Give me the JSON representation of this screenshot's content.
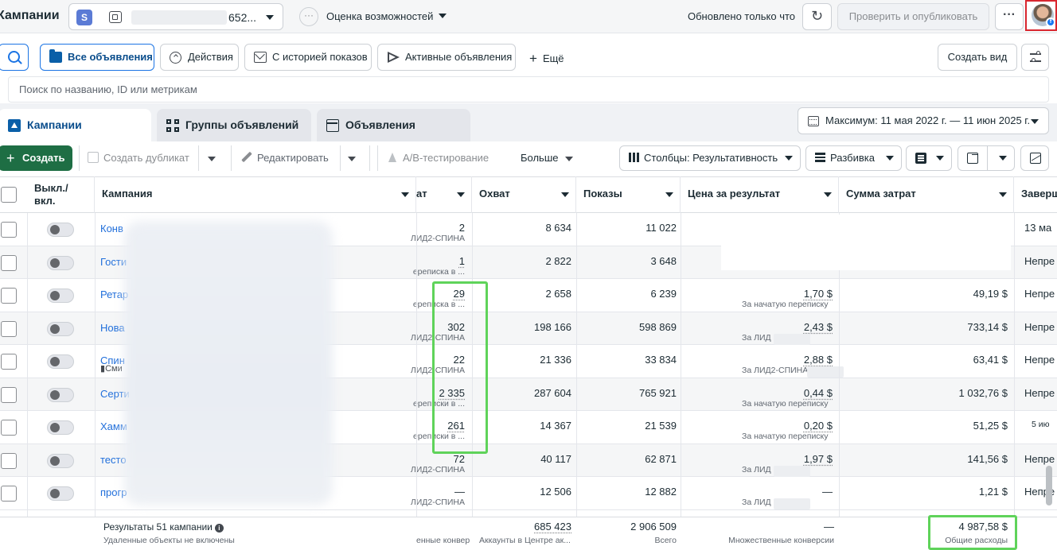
{
  "topbar": {
    "app_title": "Кампании",
    "account_badge": "S",
    "account_number": "652...",
    "opportunity_icon": "···",
    "opportunity_label": "Оценка возможностей",
    "updated_text": "Обновлено только что",
    "publish_label": "Проверить и опубликовать",
    "more_label": "···",
    "refresh_icon": "↻"
  },
  "filters": {
    "items": [
      {
        "label": "Все объявления",
        "icon": "folder-icon",
        "active": true
      },
      {
        "label": "Действия",
        "icon": "actions-icon",
        "active": false
      },
      {
        "label": "С историей показов",
        "icon": "envelope-icon",
        "active": false
      },
      {
        "label": "Активные объявления",
        "icon": "send-icon",
        "active": false
      }
    ],
    "more_label": "Ещё",
    "create_view_label": "Создать вид"
  },
  "search": {
    "placeholder": "Поиск по названию, ID или метрикам"
  },
  "tabs": {
    "items": [
      {
        "label": "Кампании",
        "icon": "campaign-icon",
        "active": true
      },
      {
        "label": "Группы объявлений",
        "icon": "grid-icon",
        "active": false
      },
      {
        "label": "Объявления",
        "icon": "ad-icon",
        "active": false
      }
    ],
    "date_range": "Максимум: 11 мая 2022 г. — 11 июн 2025 г."
  },
  "toolbar": {
    "create_label": "Создать",
    "duplicate_label": "Создать дубликат",
    "edit_label": "Редактировать",
    "ab_test_label": "A/B-тестирование",
    "more_label": "Больше",
    "columns_label": "Столбцы: Результативность",
    "breakdown_label": "Разбивка"
  },
  "table": {
    "headers": {
      "toggle": [
        "Выкл./",
        "вкл."
      ],
      "campaign": "Кампания",
      "results": "ат",
      "reach": "Охват",
      "impressions": "Показы",
      "cost_per_result": "Цена за результат",
      "amount_spent": "Сумма затрат",
      "end": "Заверш"
    },
    "rows": [
      {
        "name": "Конв",
        "sub": "",
        "results": "2",
        "results_sub": "ЛИД2-СПИНА",
        "reach": "8 634",
        "impressions": "11 022",
        "cost": "",
        "cost_sub": "",
        "spent": "",
        "end": "13 ма"
      },
      {
        "name": "Гости",
        "sub": "",
        "results": "1",
        "results_sub": "ереписка в ...",
        "reach": "2 822",
        "impressions": "3 648",
        "cost": "",
        "cost_sub": "",
        "spent": "",
        "end": "Непре"
      },
      {
        "name": "Ретар",
        "sub": "",
        "results": "29",
        "results_sub": "ереписка в ...",
        "reach": "2 658",
        "impressions": "6 239",
        "cost": "1,70 $",
        "cost_sub": "За начатую переписку",
        "spent": "49,19 $",
        "end": "Непре"
      },
      {
        "name": "Нова",
        "sub": "",
        "results": "302",
        "results_sub": "ЛИД2-СПИНА",
        "reach": "198 166",
        "impressions": "598 869",
        "cost": "2,43 $",
        "cost_sub": "За ЛИД",
        "spent": "733,14 $",
        "end": "Непре"
      },
      {
        "name": "Спин",
        "sub": "Сми",
        "results": "22",
        "results_sub": "ЛИД2-СПИНА",
        "reach": "21 336",
        "impressions": "33 834",
        "cost": "2,88 $",
        "cost_sub": "За ЛИД2-СПИНА",
        "spent": "63,41 $",
        "end": "Непре"
      },
      {
        "name": "Серти",
        "sub": "",
        "results": "2 335",
        "results_sub": "ереписки в ...",
        "reach": "287 604",
        "impressions": "765 921",
        "cost": "0,44 $",
        "cost_sub": "За начатую переписку",
        "spent": "1 032,76 $",
        "end": "Непре"
      },
      {
        "name": "Хамм",
        "sub": "",
        "results": "261",
        "results_sub": "ереписки в ...",
        "reach": "14 367",
        "impressions": "21 539",
        "cost": "0,20 $",
        "cost_sub": "За начатую переписку",
        "spent": "51,25 $",
        "end": "5 ию"
      },
      {
        "name": "тесто",
        "sub": "",
        "results": "72",
        "results_sub": "ЛИД2-СПИНА",
        "reach": "40 117",
        "impressions": "62 871",
        "cost": "1,97 $",
        "cost_sub": "За ЛИД",
        "spent": "141,56 $",
        "end": "Непре"
      },
      {
        "name": "прогр",
        "sub": "",
        "results": "—",
        "results_sub": "ЛИД2-СПИНА",
        "reach": "12 506",
        "impressions": "12 882",
        "cost": "—",
        "cost_sub": "За ЛИД",
        "spent": "1,21 $",
        "end": "Непре"
      }
    ],
    "totals": {
      "label": "Результаты 51 кампании",
      "info_icon": "i",
      "label_sub": "Удаленные объекты не включены",
      "results_sub": "енные конвер",
      "reach": "685 423",
      "reach_sub": "Аккаунты в Центре ак...",
      "impressions": "2 906 509",
      "impressions_sub": "Всего",
      "cost": "—",
      "cost_sub": "Множественные конверсии",
      "spent": "4 987,58 $",
      "spent_sub": "Общие расходы"
    }
  }
}
